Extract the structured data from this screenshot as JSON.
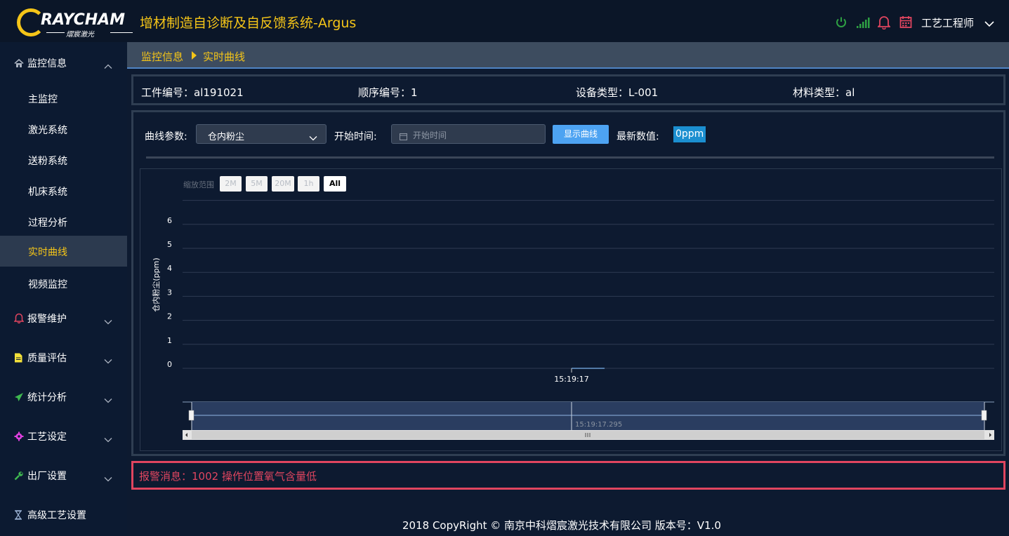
{
  "header": {
    "logo_text": "RAYCHAM",
    "logo_sub": "熠宸激光",
    "app_title": "增材制造自诊断及自反馈系统-Argus",
    "user_name": "工艺工程师",
    "icons": [
      "power-icon",
      "signal-icon",
      "bell-icon",
      "calendar-icon",
      "chevron-down-icon"
    ],
    "colors": {
      "power": "#2ea043",
      "signal": "#2ea043",
      "bell": "#e0455f",
      "calendar": "#e0455f",
      "accent": "#f5c518"
    }
  },
  "sidebar": {
    "groups": [
      {
        "label": "监控信息",
        "icon": "home-icon",
        "expanded": true
      },
      {
        "label": "报警维护",
        "icon": "bell-icon"
      },
      {
        "label": "质量评估",
        "icon": "document-icon"
      },
      {
        "label": "统计分析",
        "icon": "paper-plane-icon"
      },
      {
        "label": "工艺设定",
        "icon": "gear-icon"
      },
      {
        "label": "出厂设置",
        "icon": "wrench-icon"
      },
      {
        "label": "高级工艺设置",
        "icon": "hourglass-icon"
      }
    ],
    "sub_items": [
      "主监控",
      "激光系统",
      "送粉系统",
      "机床系统",
      "过程分析",
      "实时曲线",
      "视频监控"
    ],
    "active_item": "实时曲线"
  },
  "breadcrumb": {
    "parent": "监控信息",
    "current": "实时曲线"
  },
  "info": {
    "workpiece_label": "工件编号：",
    "workpiece": "al191021",
    "seq_label": "顺序编号：",
    "seq": "1",
    "device_label": "设备类型：",
    "device": "L-001",
    "material_label": "材料类型：",
    "material": "al"
  },
  "controls": {
    "param_label": "曲线参数:",
    "param_value": "仓内粉尘",
    "start_label": "开始时间:",
    "start_placeholder": "开始时间",
    "show_button": "显示曲线",
    "latest_label": "最新数值:",
    "latest_value": "0ppm"
  },
  "chart_zoom": {
    "label": "缩放范围",
    "buttons": [
      "2M",
      "5M",
      "20M",
      "1h",
      "All"
    ],
    "selected": "All"
  },
  "chart_data": {
    "type": "line",
    "ylabel": "仓内粉尘(ppm)",
    "xlabel": "",
    "ylim": [
      0,
      6
    ],
    "y_ticks": [
      "0",
      "1",
      "2",
      "3",
      "4",
      "5",
      "6"
    ],
    "x_ticks": [
      "15:19:17"
    ],
    "navigator_label": "15:19:17.295",
    "series": [
      {
        "values": [
          0,
          0
        ]
      }
    ],
    "grid": true
  },
  "alarm": {
    "text": "报警消息：1002 操作位置氧气含量低"
  },
  "footer": {
    "text": "2018 CopyRight © 南京中科熠宸激光技术有限公司 版本号：V1.0"
  }
}
